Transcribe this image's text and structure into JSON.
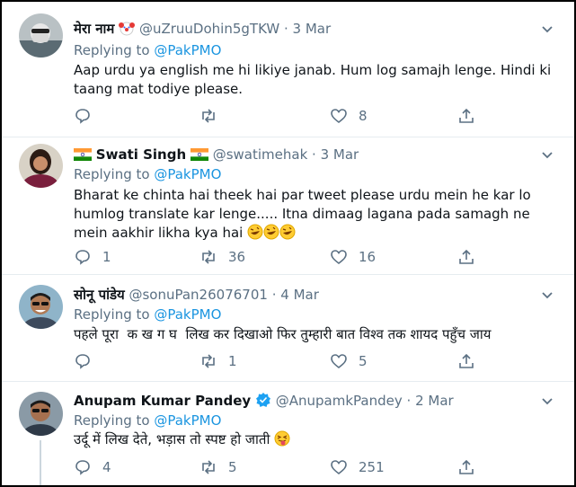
{
  "tweets": [
    {
      "name": "मेरा नाम",
      "name_emoji": "clown-face-icon",
      "handle": "@uZruuDohin5gTKW",
      "dot": "·",
      "date": "3 Mar",
      "replying_prefix": "Replying to",
      "replying_to": "@PakPMO",
      "text": "Aap urdu ya english me hi likiye janab. Hum log samajh lenge. Hindi ki taang mat todiye please.",
      "replies": "",
      "retweets": "",
      "likes": "8"
    },
    {
      "name": "Swati Singh",
      "handle": "@swatimehak",
      "dot": "·",
      "date": "3 Mar",
      "replying_prefix": "Replying to",
      "replying_to": "@PakPMO",
      "text": "Bharat ke chinta hai theek hai par tweet please urdu mein he kar lo humlog translate kar lenge..... Itna dimaag lagana pada samagh ne mein aakhir likha kya hai",
      "replies": "1",
      "retweets": "36",
      "likes": "16"
    },
    {
      "name": "सोनू पांडेय",
      "handle": "@sonuPan26076701",
      "dot": "·",
      "date": "4 Mar",
      "replying_prefix": "Replying to",
      "replying_to": "@PakPMO",
      "text": "पहले पूरा  क ख ग घ  लिख कर दिखाओ फिर तुम्हारी बात विश्व तक शायद पहुँच जाय",
      "replies": "",
      "retweets": "1",
      "likes": "5"
    },
    {
      "name": "Anupam Kumar Pandey",
      "handle": "@AnupamkPandey",
      "dot": "·",
      "date": "2 Mar",
      "replying_prefix": "Replying to",
      "replying_to": "@PakPMO",
      "text": "उर्दू में लिख देते, भड़ास तो स्पष्ट हो जाती",
      "replies": "4",
      "retweets": "5",
      "likes": "251"
    }
  ],
  "colors": {
    "accent": "#1b95e0",
    "secondary_text": "#5b7083",
    "divider": "#e6ecf0",
    "verified": "#1da1f2"
  }
}
